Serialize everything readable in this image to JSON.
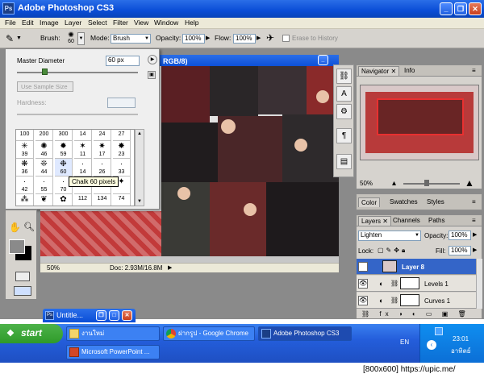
{
  "app": {
    "title": "Adobe Photoshop CS3",
    "logo": "Ps"
  },
  "menu": [
    "File",
    "Edit",
    "Image",
    "Layer",
    "Select",
    "Filter",
    "View",
    "Window",
    "Help"
  ],
  "options": {
    "brush_label": "Brush:",
    "brush_size": "60",
    "mode_label": "Mode:",
    "mode_value": "Brush",
    "opacity_label": "Opacity:",
    "opacity_value": "100%",
    "flow_label": "Flow:",
    "flow_value": "100%",
    "erase_history": "Erase to History"
  },
  "brush_popup": {
    "master_diameter_label": "Master Diameter",
    "master_diameter_value": "60 px",
    "master_diameter_fraction": 0.22,
    "use_sample_size": "Use Sample Size",
    "hardness_label": "Hardness:",
    "tooltip": "Chalk 60 pixels",
    "sizes_row1": [
      "100",
      "200",
      "300",
      "14",
      "24",
      "27"
    ],
    "sizes_row2": [
      "39",
      "46",
      "59",
      "11",
      "17",
      "23"
    ],
    "sizes_row3": [
      "36",
      "44",
      "60",
      "14",
      "26",
      "33"
    ],
    "sizes_row4": [
      "42",
      "55",
      "70",
      "",
      "",
      ""
    ],
    "sizes_row5": [
      "",
      "",
      "",
      "112",
      "134",
      "74"
    ]
  },
  "document": {
    "title_suffix": "RGB/8)",
    "zoom": "50%",
    "doc_size": "Doc: 2.93M/16.8M"
  },
  "navigator": {
    "tab_active": "Navigator",
    "tab_other": "Info",
    "zoom": "50%"
  },
  "color_panel": {
    "tabs": [
      "Color",
      "Swatches",
      "Styles"
    ]
  },
  "layers_panel": {
    "tabs": [
      "Layers",
      "Channels",
      "Paths"
    ],
    "blend_mode": "Lighten",
    "opacity_label": "Opacity:",
    "opacity_value": "100%",
    "lock_label": "Lock:",
    "fill_label": "Fill:",
    "fill_value": "100%",
    "layers": [
      {
        "name": "Layer 8",
        "selected": true
      },
      {
        "name": "Levels 1",
        "selected": false
      },
      {
        "name": "Curves 1",
        "selected": false
      }
    ]
  },
  "minimized_doc": {
    "title": "Untitle..."
  },
  "taskbar": {
    "start": "start",
    "tasks": [
      {
        "label": "งานใหม่",
        "active": false
      },
      {
        "label": "ฝากรูป - Google Chrome",
        "active": false
      },
      {
        "label": "Adobe Photoshop CS3",
        "active": true
      },
      {
        "label": "Microsoft PowerPoint ...",
        "active": false
      }
    ],
    "language": "EN",
    "time": "23:01",
    "day": "อาทิตย์"
  },
  "watermark": "[800x600] https://upic.me/",
  "colors": {
    "titlebar": "#0a4dd6",
    "panel_bg": "#d6d3ce",
    "selection": "#3465c8",
    "start_green": "#2f9a2a"
  }
}
